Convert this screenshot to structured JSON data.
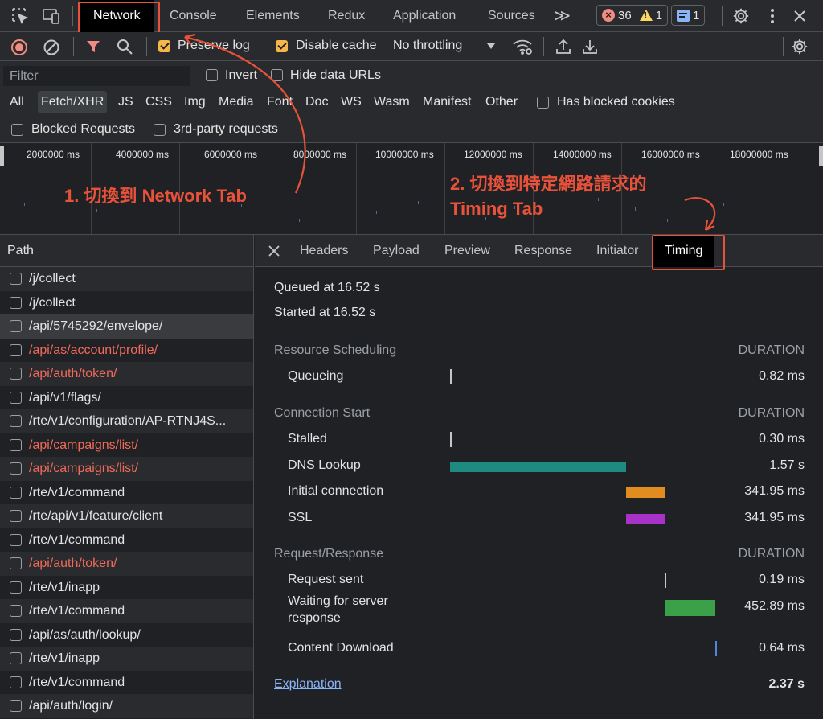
{
  "tabs": [
    {
      "label": "Network",
      "active": true
    },
    {
      "label": "Console"
    },
    {
      "label": "Elements"
    },
    {
      "label": "Redux"
    },
    {
      "label": "Application"
    },
    {
      "label": "Sources"
    }
  ],
  "tabs_more": "≫",
  "badges": {
    "errors": "36",
    "warnings": "1",
    "messages": "1"
  },
  "toolbar": {
    "preserve_log": "Preserve log",
    "disable_cache": "Disable cache",
    "throttling": "No throttling"
  },
  "filter": {
    "placeholder": "Filter",
    "invert": "Invert",
    "hide_data_urls": "Hide data URLs"
  },
  "type_filters": [
    "All",
    "Fetch/XHR",
    "JS",
    "CSS",
    "Img",
    "Media",
    "Font",
    "Doc",
    "WS",
    "Wasm",
    "Manifest",
    "Other"
  ],
  "has_blocked_cookies": "Has blocked cookies",
  "blocked_requests": "Blocked Requests",
  "third_party": "3rd-party requests",
  "overview_ticks": [
    "2000000 ms",
    "4000000 ms",
    "6000000 ms",
    "8000000 ms",
    "10000000 ms",
    "12000000 ms",
    "14000000 ms",
    "16000000 ms",
    "18000000 ms"
  ],
  "annotations": {
    "step1": "1. 切換到 Network Tab",
    "step2_line1": "2. 切換到特定網路請求的",
    "step2_line2": "Timing Tab"
  },
  "list": {
    "header": "Path",
    "rows": [
      {
        "path": "/j/collect",
        "status": "ok"
      },
      {
        "path": "/j/collect",
        "status": "ok"
      },
      {
        "path": "/api/5745292/envelope/",
        "status": "ok",
        "selected": true
      },
      {
        "path": "/api/as/account/profile/",
        "status": "error"
      },
      {
        "path": "/api/auth/token/",
        "status": "error"
      },
      {
        "path": "/api/v1/flags/",
        "status": "ok"
      },
      {
        "path": "/rte/v1/configuration/AP-RTNJ4S...",
        "status": "ok"
      },
      {
        "path": "/api/campaigns/list/",
        "status": "error"
      },
      {
        "path": "/api/campaigns/list/",
        "status": "error"
      },
      {
        "path": "/rte/v1/command",
        "status": "ok"
      },
      {
        "path": "/rte/api/v1/feature/client",
        "status": "ok"
      },
      {
        "path": "/rte/v1/command",
        "status": "ok"
      },
      {
        "path": "/api/auth/token/",
        "status": "error"
      },
      {
        "path": "/rte/v1/inapp",
        "status": "ok"
      },
      {
        "path": "/rte/v1/command",
        "status": "ok"
      },
      {
        "path": "/api/as/auth/lookup/",
        "status": "ok"
      },
      {
        "path": "/rte/v1/inapp",
        "status": "ok"
      },
      {
        "path": "/rte/v1/command",
        "status": "ok"
      },
      {
        "path": "/api/auth/login/",
        "status": "ok"
      }
    ]
  },
  "detail_tabs": [
    "Headers",
    "Payload",
    "Preview",
    "Response",
    "Initiator",
    "Timing"
  ],
  "timing": {
    "queued": "Queued at 16.52 s",
    "started": "Started at 16.52 s",
    "duration_header": "DURATION",
    "sections": [
      {
        "title": "Resource Scheduling",
        "rows": [
          {
            "label": "Queueing",
            "value": "0.82 ms",
            "bar_start": 0.0,
            "bar_width": 0.003,
            "color": "#c4c7c5"
          }
        ]
      },
      {
        "title": "Connection Start",
        "rows": [
          {
            "label": "Stalled",
            "value": "0.30 ms",
            "bar_start": 0.0,
            "bar_width": 0.002,
            "color": "#c4c7c5"
          },
          {
            "label": "DNS Lookup",
            "value": "1.57 s",
            "bar_start": 0.0,
            "bar_width": 0.665,
            "color": "#1f8a80"
          },
          {
            "label": "Initial connection",
            "value": "341.95 ms",
            "bar_start": 0.665,
            "bar_width": 0.145,
            "color": "#e08c1e"
          },
          {
            "label": "SSL",
            "value": "341.95 ms",
            "bar_start": 0.665,
            "bar_width": 0.145,
            "color": "#a832c8"
          }
        ]
      },
      {
        "title": "Request/Response",
        "rows": [
          {
            "label": "Request sent",
            "value": "0.19 ms",
            "bar_start": 0.81,
            "bar_width": 0.002,
            "color": "#c4c7c5"
          },
          {
            "label": "Waiting for server response",
            "label_line1": "Waiting for server",
            "label_line2": "response",
            "value": "452.89 ms",
            "bar_start": 0.81,
            "bar_width": 0.191,
            "color": "#3aa04a"
          },
          {
            "label": "Content Download",
            "value": "0.64 ms",
            "bar_start": 1.0,
            "bar_width": 0.002,
            "color": "#4a8ad8"
          }
        ]
      }
    ],
    "explanation": "Explanation",
    "total": "2.37 s"
  }
}
